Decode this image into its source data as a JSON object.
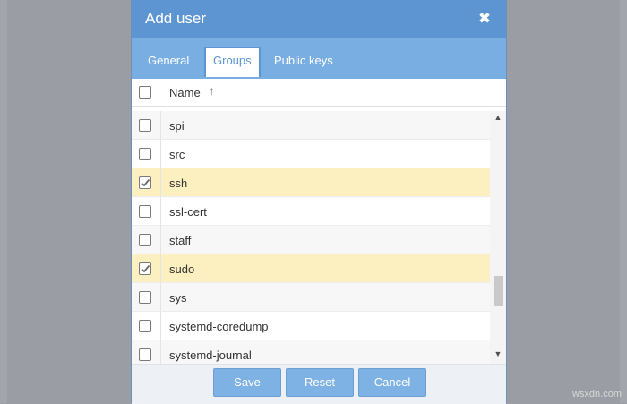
{
  "dialog": {
    "title": "Add user",
    "close_icon": "close-icon"
  },
  "tabs": [
    {
      "label": "General",
      "active": false
    },
    {
      "label": "Groups",
      "active": true
    },
    {
      "label": "Public keys",
      "active": false
    }
  ],
  "grid": {
    "header_name": "Name",
    "sort": "ascending",
    "rows": [
      {
        "name": "spi",
        "checked": false
      },
      {
        "name": "src",
        "checked": false
      },
      {
        "name": "ssh",
        "checked": true
      },
      {
        "name": "ssl-cert",
        "checked": false
      },
      {
        "name": "staff",
        "checked": false
      },
      {
        "name": "sudo",
        "checked": true
      },
      {
        "name": "sys",
        "checked": false
      },
      {
        "name": "systemd-coredump",
        "checked": false
      },
      {
        "name": "systemd-journal",
        "checked": false
      }
    ]
  },
  "buttons": {
    "save": "Save",
    "reset": "Reset",
    "cancel": "Cancel"
  },
  "watermark": "wsxdn.com",
  "colors": {
    "titlebar": "#5d95d3",
    "tabbar": "#79aee2",
    "selected_row": "#fcf0c0",
    "button": "#7eb1e4"
  }
}
